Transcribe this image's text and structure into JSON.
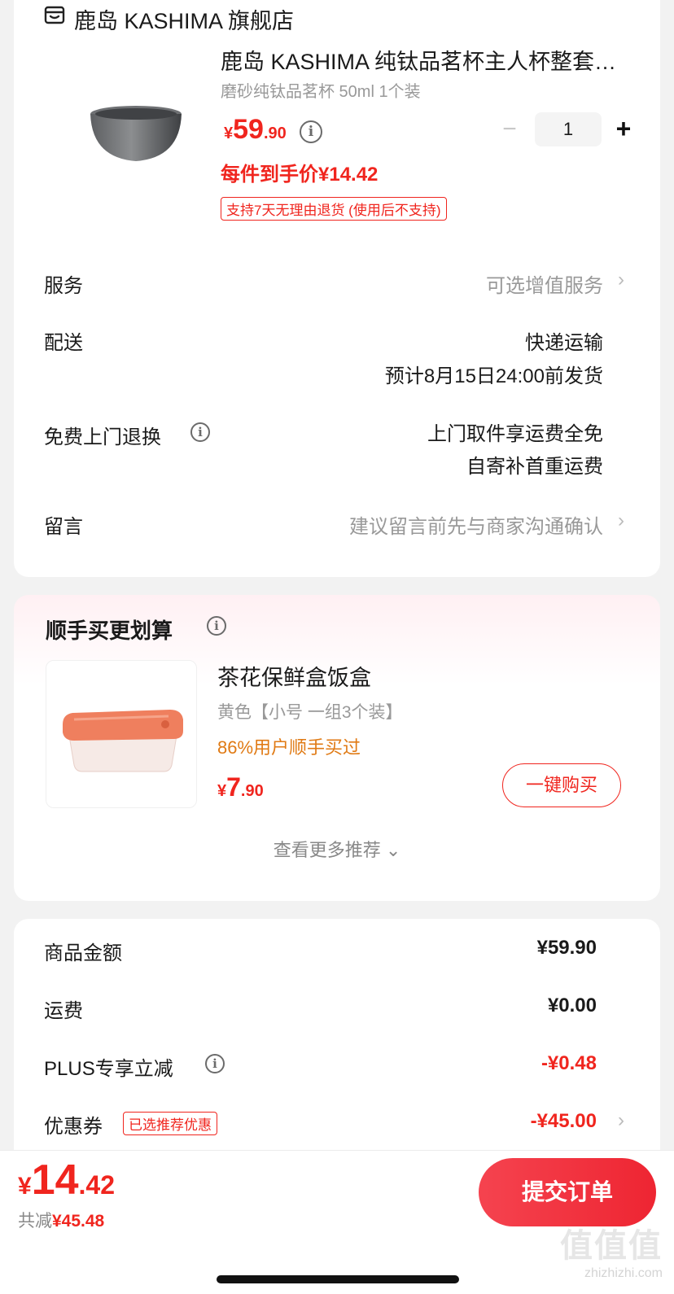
{
  "store": {
    "name": "鹿岛 KASHIMA 旗舰店",
    "product": {
      "title": "鹿岛 KASHIMA 纯钛品茗杯主人杯整套…",
      "spec": "磨砂纯钛品茗杯 50ml 1个装",
      "price_symbol": "¥",
      "price_int": "59",
      "price_dec": ".90",
      "quantity": "1",
      "minus": "−",
      "plus": "+",
      "final_price": "每件到手价¥14.42",
      "return_tag": "支持7天无理由退货 (使用后不支持)"
    },
    "rows": {
      "service_label": "服务",
      "service_value": "可选增值服务",
      "delivery_label": "配送",
      "delivery_value1": "快递运输",
      "delivery_value2": "预计8月15日24:00前发货",
      "free_return_label": "免费上门退换",
      "free_return_value1": "上门取件享运费全免",
      "free_return_value2": "自寄补首重运费",
      "message_label": "留言",
      "message_value": "建议留言前先与商家沟通确认"
    }
  },
  "recommend": {
    "title": "顺手买更划算",
    "item": {
      "name": "茶花保鲜盒饭盒",
      "spec": "黄色【小号 一组3个装】",
      "percent": "86%用户顺手买过",
      "price_symbol": "¥",
      "price_int": "7",
      "price_dec": ".90",
      "buy_label": "一键购买"
    },
    "more_label": "查看更多推荐 ⌄"
  },
  "summary": {
    "goods_label": "商品金额",
    "goods_value": "¥59.90",
    "shipping_label": "运费",
    "shipping_value": "¥0.00",
    "plus_label": "PLUS专享立减",
    "plus_value": "-¥0.48",
    "coupon_label": "优惠券",
    "coupon_tag": "已选推荐优惠",
    "coupon_value": "-¥45.00"
  },
  "bottom": {
    "total_symbol": "¥",
    "total_int": "14",
    "total_dec": ".42",
    "saved_prefix": "共减",
    "saved_value": "¥45.48",
    "submit_label": "提交订单"
  },
  "watermark": {
    "text": "值值值",
    "url": "zhizhizhi.com"
  },
  "icons": {
    "store": "store-icon",
    "info": "info-icon",
    "chevron": "chevron-right-icon"
  },
  "colors": {
    "accent": "#f0251e",
    "orange": "#e07a14"
  }
}
